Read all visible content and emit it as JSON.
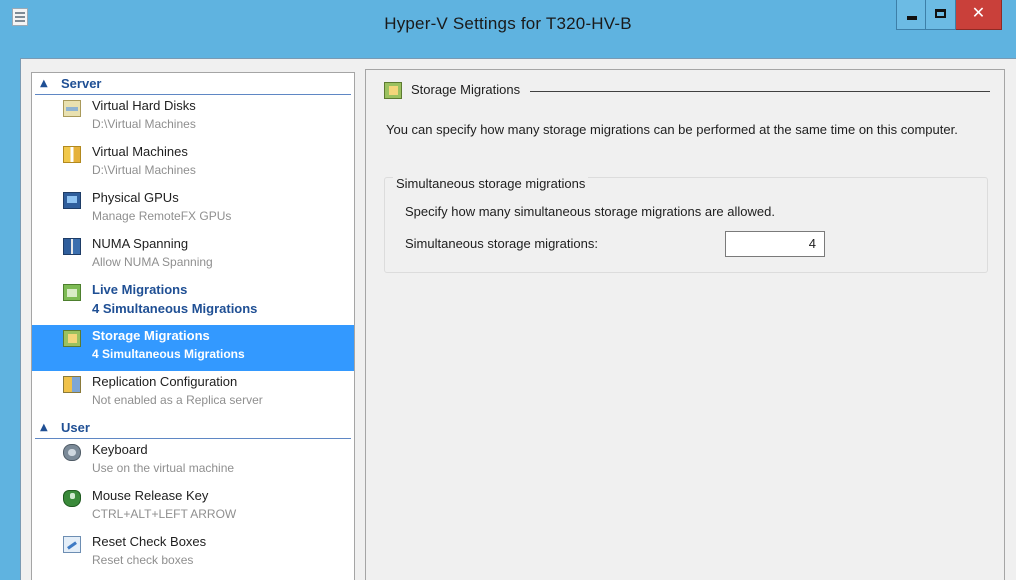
{
  "window": {
    "title": "Hyper-V Settings for T320-HV-B",
    "controls": {
      "minimize": "minimize-icon",
      "maximize": "maximize-icon",
      "close": "close-icon"
    }
  },
  "nav": {
    "sections": [
      {
        "header": "Server",
        "items": [
          {
            "label": "Virtual Hard Disks",
            "sub": "D:\\Virtual Machines",
            "icon": "virtual-hard-disk-icon",
            "style": "normal"
          },
          {
            "label": "Virtual Machines",
            "sub": "D:\\Virtual Machines",
            "icon": "virtual-machines-folder-icon",
            "style": "normal"
          },
          {
            "label": "Physical GPUs",
            "sub": "Manage RemoteFX GPUs",
            "icon": "gpu-icon",
            "style": "normal"
          },
          {
            "label": "NUMA Spanning",
            "sub": "Allow NUMA Spanning",
            "icon": "numa-icon",
            "style": "normal"
          },
          {
            "label": "Live Migrations",
            "sub": "4 Simultaneous Migrations",
            "icon": "live-migration-icon",
            "style": "blue"
          },
          {
            "label": "Storage Migrations",
            "sub": "4 Simultaneous Migrations",
            "icon": "storage-migration-icon",
            "style": "selected"
          },
          {
            "label": "Replication Configuration",
            "sub": "Not enabled as a Replica server",
            "icon": "replication-icon",
            "style": "normal"
          }
        ]
      },
      {
        "header": "User",
        "items": [
          {
            "label": "Keyboard",
            "sub": "Use on the virtual machine",
            "icon": "keyboard-icon",
            "style": "normal"
          },
          {
            "label": "Mouse Release Key",
            "sub": "CTRL+ALT+LEFT ARROW",
            "icon": "mouse-icon",
            "style": "normal"
          },
          {
            "label": "Reset Check Boxes",
            "sub": "Reset check boxes",
            "icon": "reset-checkbox-icon",
            "style": "normal"
          }
        ]
      }
    ]
  },
  "content": {
    "heading": "Storage Migrations",
    "description": "You can specify how many storage migrations can be performed at the same time on this computer.",
    "group": {
      "title": "Simultaneous storage migrations",
      "text": "Specify how many simultaneous storage migrations are allowed.",
      "field_label": "Simultaneous storage migrations:",
      "field_value": "4"
    }
  },
  "colors": {
    "selected_bg": "#3399ff",
    "link_blue": "#1f4f94",
    "frame": "#5fb3e0",
    "close_button": "#c9403a"
  }
}
